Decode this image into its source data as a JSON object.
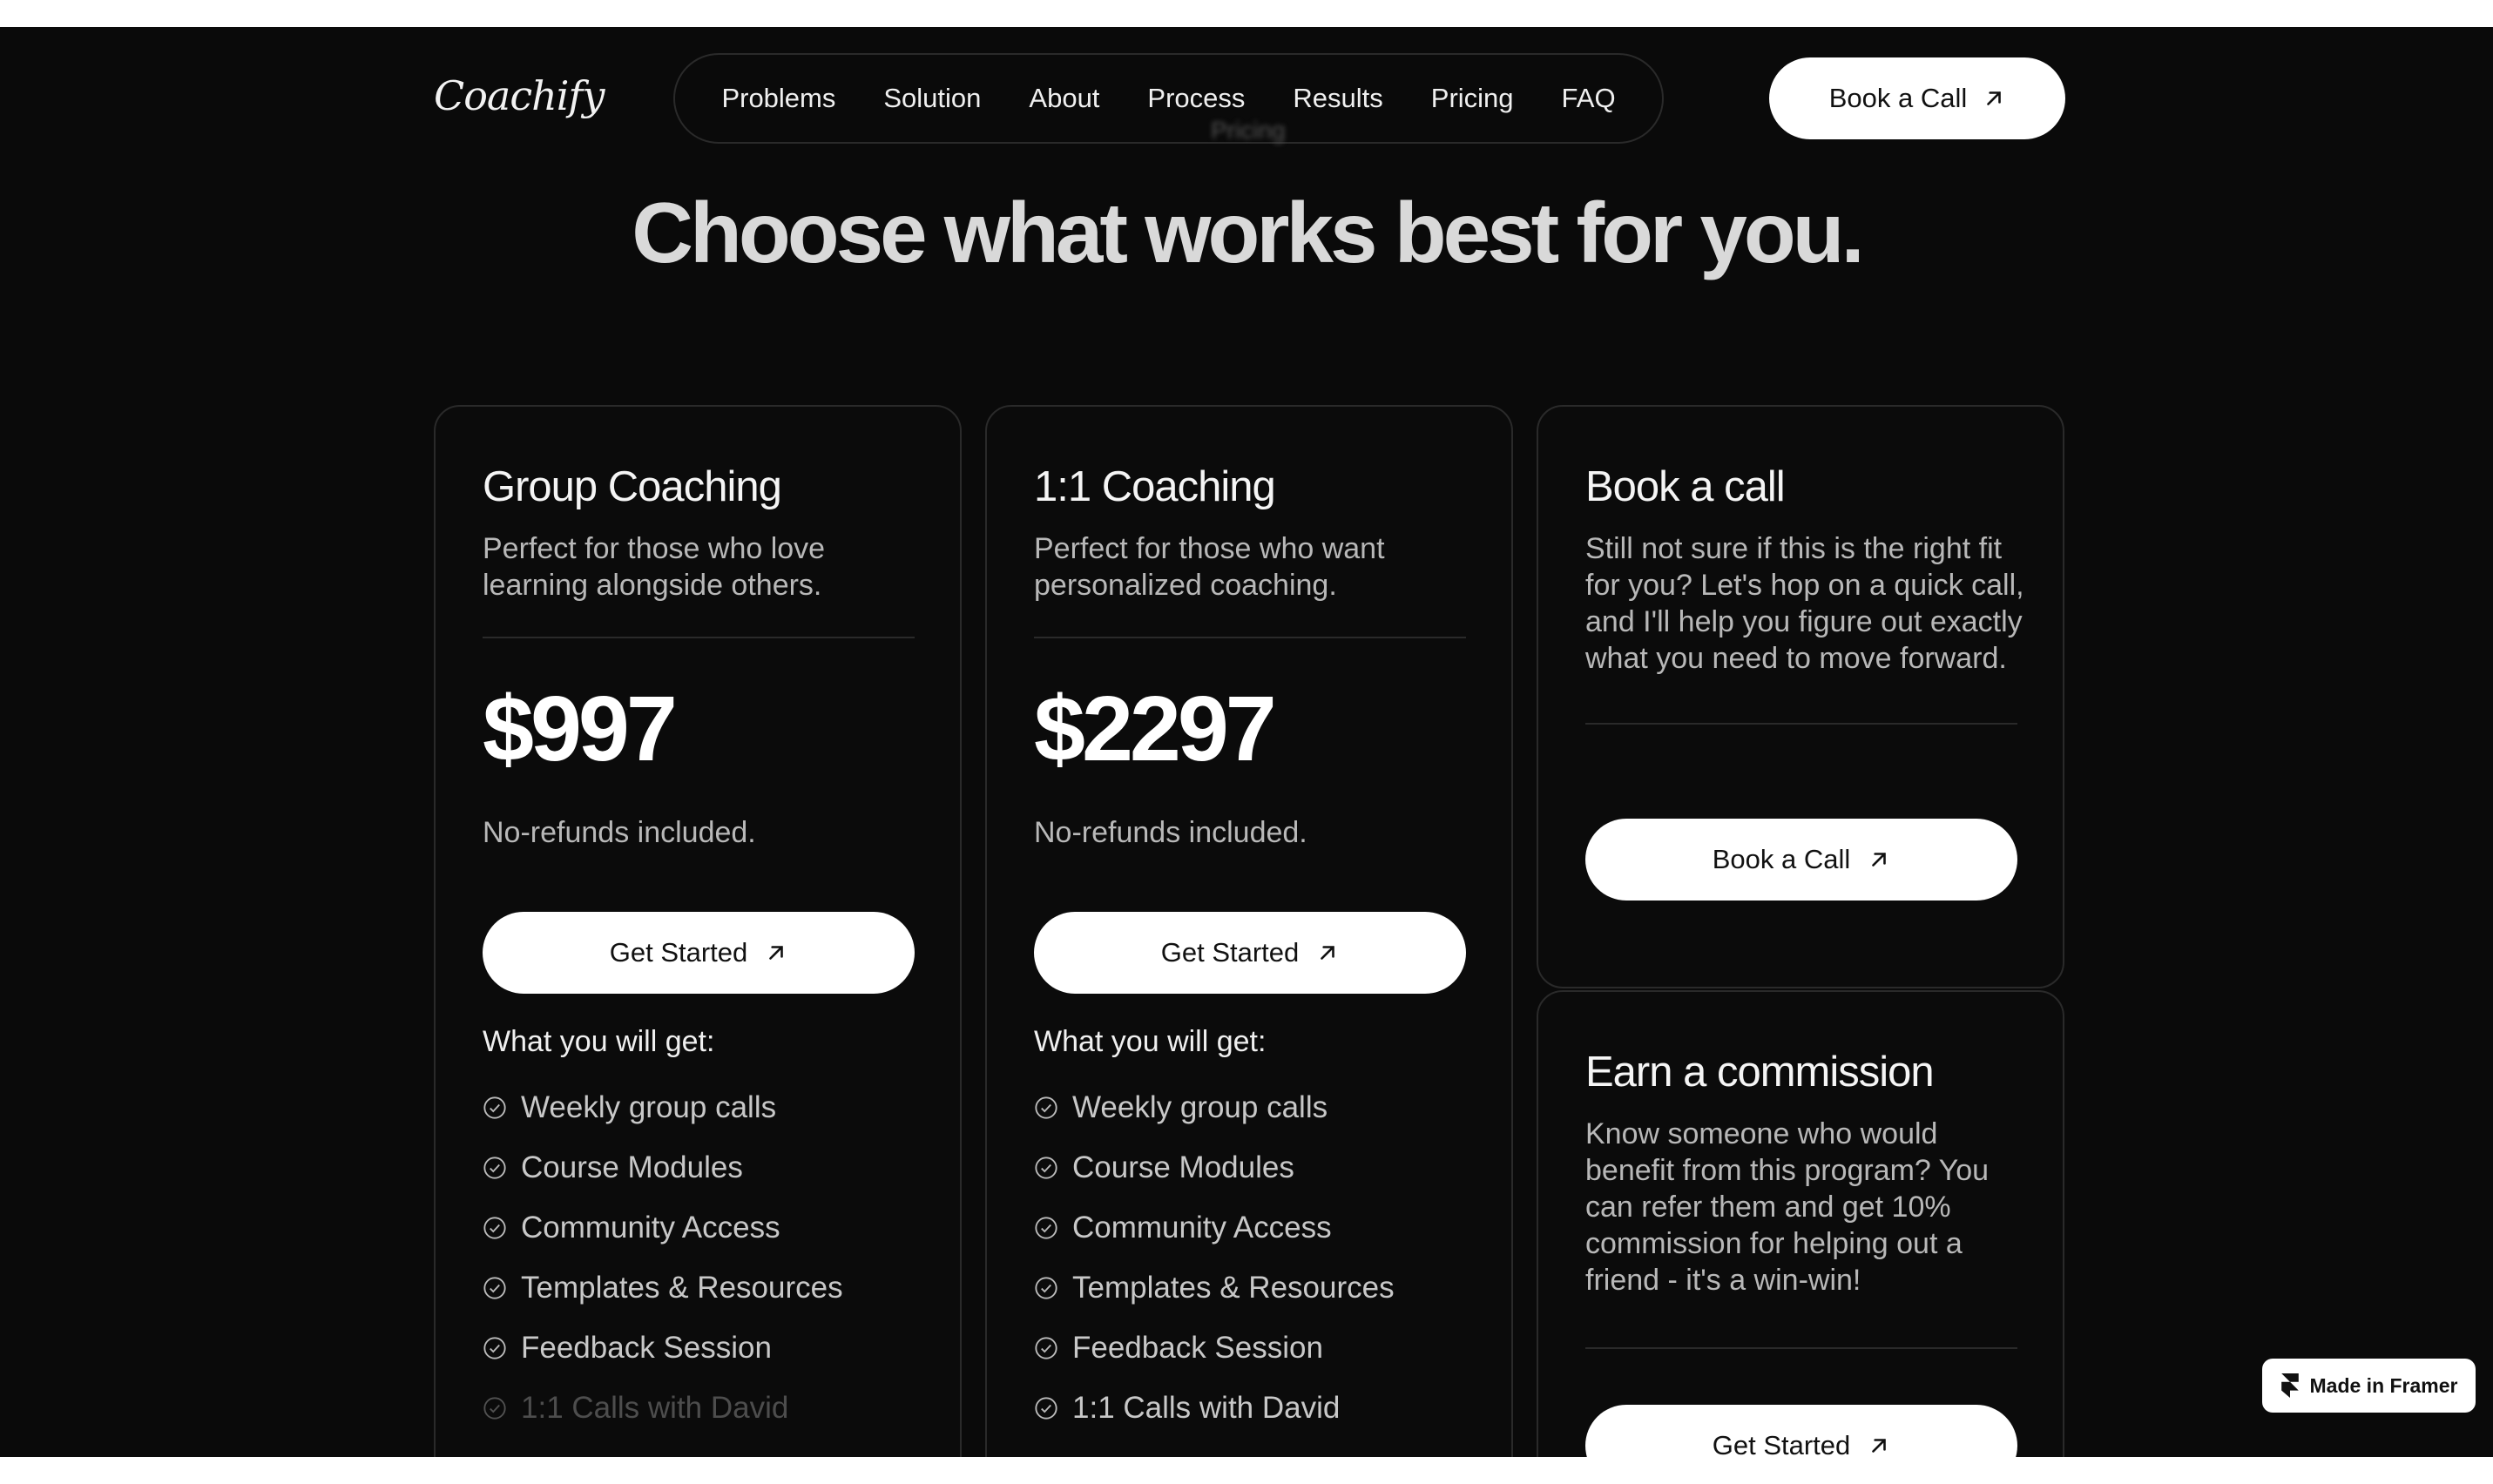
{
  "brand": {
    "logo": "Coachify"
  },
  "nav": {
    "items": [
      "Problems",
      "Solution",
      "About",
      "Process",
      "Results",
      "Pricing",
      "FAQ"
    ],
    "ghost_label": "Pricing"
  },
  "header_button": {
    "label": "Book a Call",
    "icon": "arrow-up-right-icon"
  },
  "headline": "Choose what works best for you.",
  "plans": [
    {
      "title": "Group Coaching",
      "subtitle_lines": [
        "Perfect for those who love",
        "learning alongside others."
      ],
      "price": "$997",
      "note": "No-refunds included.",
      "button": "Get Started",
      "features_title": "What you will get:",
      "features": [
        {
          "label": "Weekly group calls",
          "included": true
        },
        {
          "label": "Course Modules",
          "included": true
        },
        {
          "label": "Community Access",
          "included": true
        },
        {
          "label": "Templates & Resources",
          "included": true
        },
        {
          "label": "Feedback Session",
          "included": true
        },
        {
          "label": "1:1 Calls with David",
          "included": false
        }
      ]
    },
    {
      "title": "1:1 Coaching",
      "subtitle_lines": [
        "Perfect for those who want",
        "personalized coaching."
      ],
      "price": "$2297",
      "note": "No-refunds included.",
      "button": "Get Started",
      "features_title": "What you will get:",
      "features": [
        {
          "label": "Weekly group calls",
          "included": true
        },
        {
          "label": "Course Modules",
          "included": true
        },
        {
          "label": "Community Access",
          "included": true
        },
        {
          "label": "Templates & Resources",
          "included": true
        },
        {
          "label": "Feedback Session",
          "included": true
        },
        {
          "label": "1:1 Calls with David",
          "included": true
        }
      ]
    }
  ],
  "book_call_card": {
    "title": "Book a call",
    "text_lines": [
      "Still not sure if this is the right fit",
      "for you? Let's hop on a quick call,",
      "and I'll help you figure out exactly",
      "what you need to move forward."
    ],
    "button": "Book a Call"
  },
  "commission_card": {
    "title": "Earn a commission",
    "text_lines": [
      "Know someone who would",
      "benefit from this program? You",
      "can refer them and get 10%",
      "commission for helping out a",
      "friend - it's a win-win!"
    ],
    "button": "Get Started"
  },
  "badge": {
    "label": "Made in Framer",
    "icon": "framer-logo-icon"
  },
  "colors": {
    "background": "#0a0a0a",
    "card_border": "#2a2a2a",
    "button_bg": "#ffffff",
    "text_muted": "#b8b8b8"
  }
}
